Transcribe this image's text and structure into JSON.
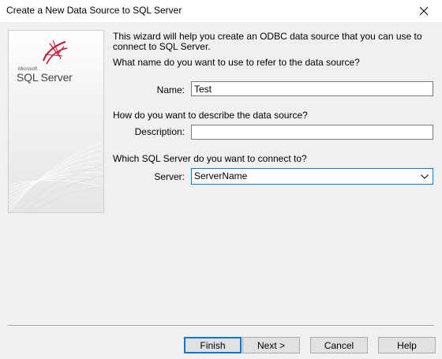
{
  "window": {
    "title": "Create a New Data Source to SQL Server"
  },
  "banner": {
    "logo_small": "Microsoft",
    "logo_text": "SQL Server"
  },
  "intro": "This wizard will help you create an ODBC data source that you can use to connect to SQL Server.",
  "questions": {
    "name": "What name do you want to use to refer to the data source?",
    "description": "How do you want to describe the data source?",
    "server": "Which SQL Server do you want to connect to?"
  },
  "fields": {
    "name_label": "Name:",
    "name_value": "Test",
    "description_label": "Description:",
    "description_value": "",
    "server_label": "Server:",
    "server_value": "ServerName"
  },
  "buttons": {
    "finish": "Finish",
    "next": "Next >",
    "cancel": "Cancel",
    "help": "Help"
  },
  "icons": [
    "close-icon",
    "sql-server-logo-icon",
    "chevron-down-icon"
  ],
  "colors": {
    "focus_accent": "#0078d7",
    "logo_red": "#c8102e"
  }
}
